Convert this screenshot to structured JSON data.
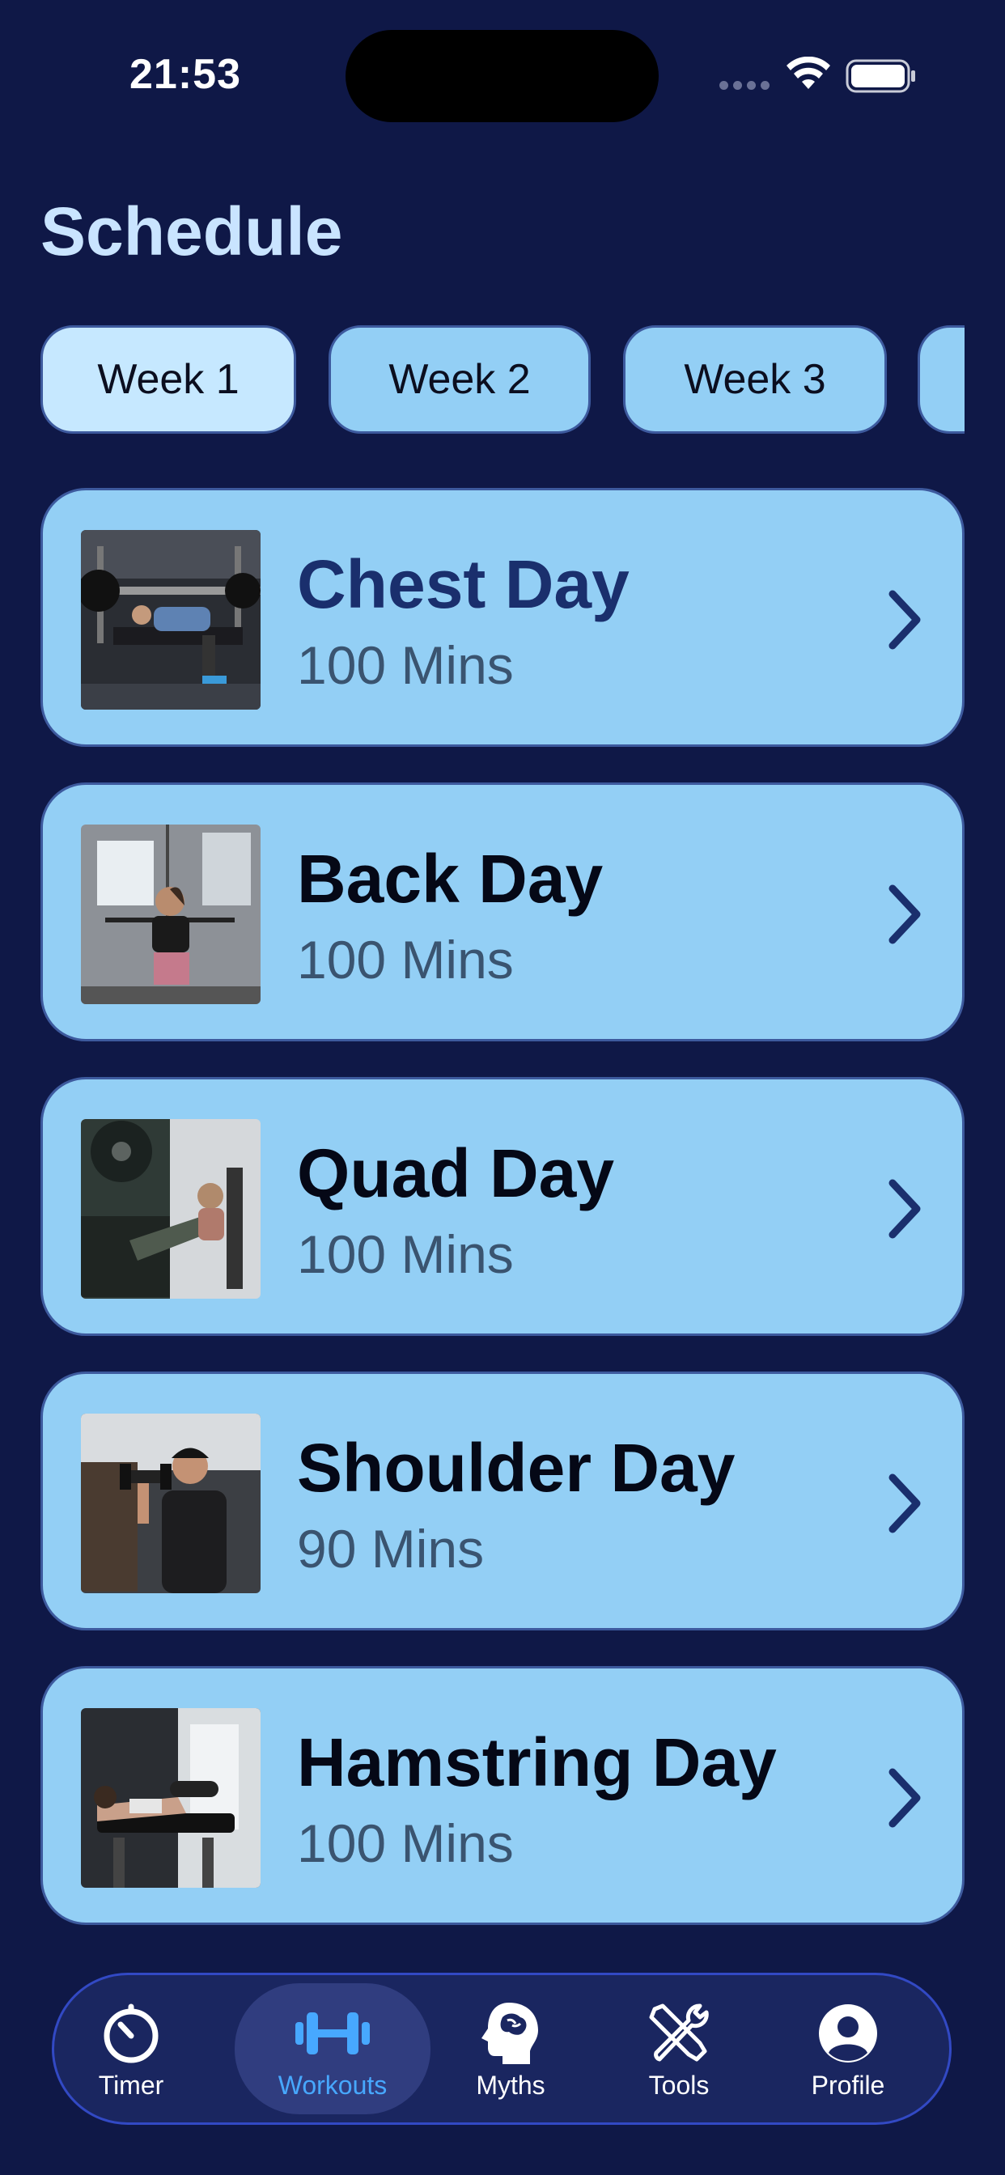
{
  "status_bar": {
    "time": "21:53"
  },
  "header": {
    "title": "Schedule"
  },
  "weeks": [
    {
      "label": "Week 1",
      "active": true
    },
    {
      "label": "Week 2",
      "active": false
    },
    {
      "label": "Week 3",
      "active": false
    },
    {
      "label": "",
      "active": false
    }
  ],
  "workouts": [
    {
      "title": "Chest Day",
      "duration": "100 Mins",
      "image": "bench-press-photo"
    },
    {
      "title": "Back Day",
      "duration": "100 Mins",
      "image": "lat-pulldown-photo"
    },
    {
      "title": "Quad Day",
      "duration": "100 Mins",
      "image": "leg-press-photo"
    },
    {
      "title": "Shoulder Day",
      "duration": "90 Mins",
      "image": "dumbbell-press-photo"
    },
    {
      "title": "Hamstring Day",
      "duration": "100 Mins",
      "image": "leg-curl-photo"
    }
  ],
  "tab_bar": {
    "items": [
      {
        "label": "Timer",
        "icon": "stopwatch-icon",
        "active": false
      },
      {
        "label": "Workouts",
        "icon": "dumbbell-icon",
        "active": true
      },
      {
        "label": "Myths",
        "icon": "brain-head-icon",
        "active": false
      },
      {
        "label": "Tools",
        "icon": "wrench-screwdriver-icon",
        "active": false
      },
      {
        "label": "Profile",
        "icon": "person-circle-icon",
        "active": false
      }
    ]
  },
  "colors": {
    "background": "#0f1847",
    "card": "#93cff5",
    "card_border": "#3d5a9e",
    "active_tab": "#47a8ff",
    "title": "#c9e4ff"
  }
}
